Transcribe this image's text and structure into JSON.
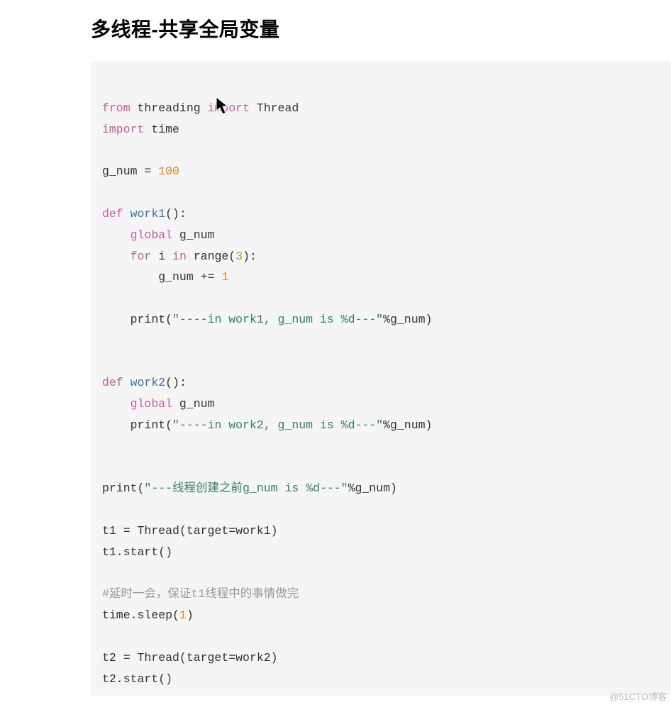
{
  "heading": "多线程-共享全局变量",
  "code": {
    "l1_kw1": "from",
    "l1_mod": " threading ",
    "l1_kw2": "import",
    "l1_sym": " Thread",
    "l2_kw": "import",
    "l2_mod": " time",
    "l4_pre": "g_num = ",
    "l4_num": "100",
    "l6_kw": "def",
    "l6_sp": " ",
    "l6_fn": "work1",
    "l6_paren": "():",
    "l7_indent": "    ",
    "l7_kw": "global",
    "l7_rest": " g_num",
    "l8_indent": "    ",
    "l8_kw1": "for",
    "l8_mid": " i ",
    "l8_kw2": "in",
    "l8_post": " range(",
    "l8_num": "3",
    "l8_end": "):",
    "l9_indent": "        ",
    "l9_text": "g_num += ",
    "l9_num": "1",
    "l11_indent": "    ",
    "l11_print": "print(",
    "l11_str": "\"----in work1, g_num is %d---\"",
    "l11_end": "%g_num)",
    "l14_kw": "def",
    "l14_sp": " ",
    "l14_fn": "work2",
    "l14_paren": "():",
    "l15_indent": "    ",
    "l15_kw": "global",
    "l15_rest": " g_num",
    "l16_indent": "    ",
    "l16_print": "print(",
    "l16_str": "\"----in work2, g_num is %d---\"",
    "l16_end": "%g_num)",
    "l19_print": "print(",
    "l19_str": "\"---线程创建之前g_num is %d---\"",
    "l19_end": "%g_num)",
    "l21": "t1 = Thread(target=work1)",
    "l22": "t1.start()",
    "l24_cm": "#延时一会，保证t1线程中的事情做完",
    "l25_pre": "time.sleep(",
    "l25_num": "1",
    "l25_end": ")",
    "l27": "t2 = Thread(target=work2)",
    "l28": "t2.start()"
  },
  "watermark": "@51CTO博客"
}
